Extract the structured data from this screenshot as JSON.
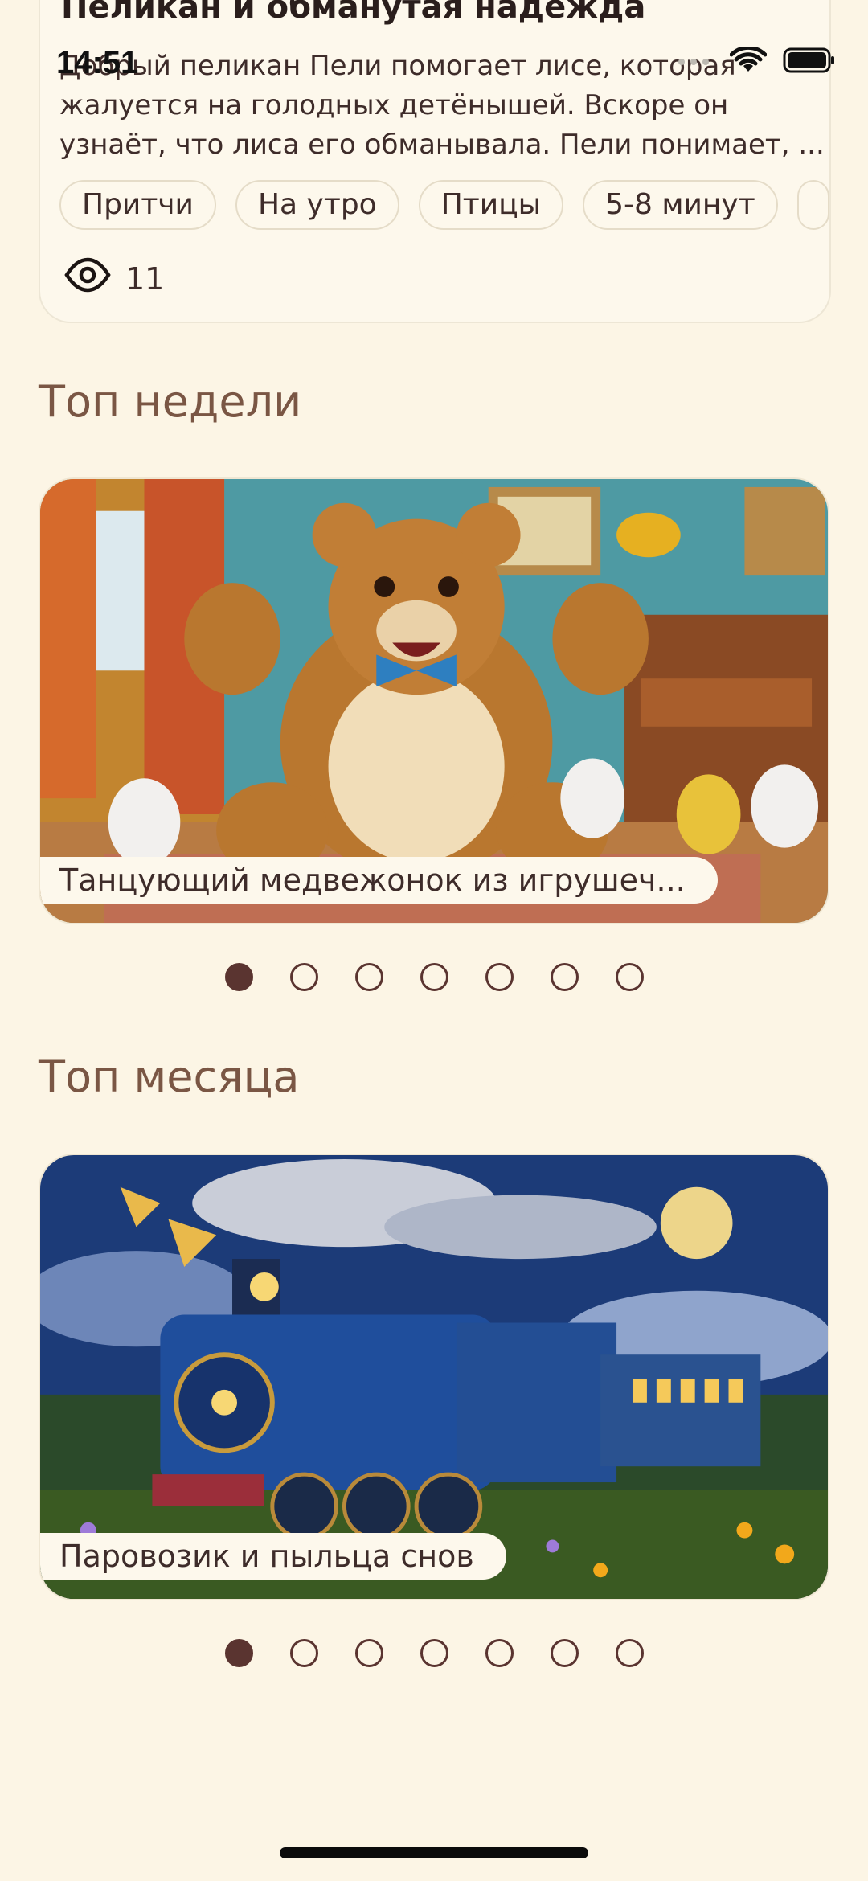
{
  "status_bar": {
    "time": "14:51"
  },
  "story_card": {
    "title": "Пеликан и обманутая надежда",
    "description_lines": [
      "Добрый пеликан Пели помогает лисе, которая",
      "жалуется на голодных детёнышей. Вскоре он",
      "узнаёт, что лиса его обманывала. Пели понимает, ..."
    ],
    "tags": [
      "Притчи",
      "На утро",
      "Птицы",
      "5-8 минут"
    ],
    "views": "11"
  },
  "top_week": {
    "title": "Топ недели",
    "caption": "Танцующий медвежонок из игрушеч...",
    "page_count": 7,
    "active_index": 0
  },
  "top_month": {
    "title": "Топ месяца",
    "caption": "Паровозик и пыльца снов",
    "page_count": 7,
    "active_index": 0
  },
  "colors": {
    "background": "#FCF5E5",
    "accent": "#5A3430",
    "section_title": "#7A5644"
  }
}
